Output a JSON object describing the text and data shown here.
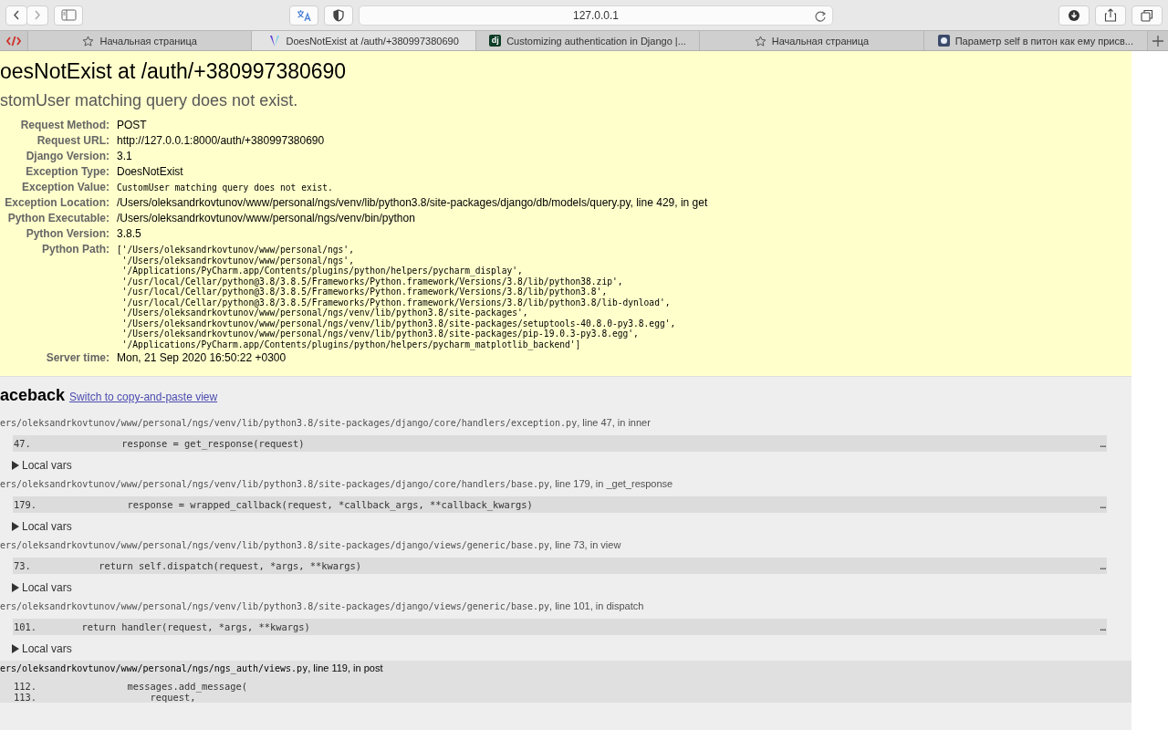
{
  "toolbar": {
    "address": "127.0.0.1"
  },
  "tabs": [
    {
      "title": "Начальная страница",
      "kind": "star",
      "selected": false
    },
    {
      "title": "DoesNotExist at /auth/+380997380690",
      "kind": "logo",
      "selected": true
    },
    {
      "title": "Customizing authentication in Django |...",
      "kind": "dj",
      "icon_text": "dj",
      "selected": false
    },
    {
      "title": "Начальная страница",
      "kind": "star",
      "selected": false
    },
    {
      "title": "Параметр self в питон как ему присв...",
      "kind": "square",
      "selected": false
    }
  ],
  "summary": {
    "title": "oesNotExist at /auth/+380997380690",
    "subtitle": "stomUser matching query does not exist.",
    "meta": [
      {
        "label": "Request Method:",
        "kind": "text",
        "value": "POST"
      },
      {
        "label": "Request URL:",
        "kind": "text",
        "value": "http://127.0.0.1:8000/auth/+380997380690"
      },
      {
        "label": "Django Version:",
        "kind": "text",
        "value": "3.1"
      },
      {
        "label": "Exception Type:",
        "kind": "text",
        "value": "DoesNotExist"
      },
      {
        "label": "Exception Value:",
        "kind": "code",
        "lines": [
          "CustomUser matching query does not exist."
        ]
      },
      {
        "label": "Exception Location:",
        "kind": "text",
        "value": "/Users/oleksandrkovtunov/www/personal/ngs/venv/lib/python3.8/site-packages/django/db/models/query.py, line 429, in get"
      },
      {
        "label": "Python Executable:",
        "kind": "text",
        "value": "/Users/oleksandrkovtunov/www/personal/ngs/venv/bin/python"
      },
      {
        "label": "Python Version:",
        "kind": "text",
        "value": "3.8.5"
      },
      {
        "label": "Python Path:",
        "kind": "code",
        "lines": [
          "['/Users/oleksandrkovtunov/www/personal/ngs',",
          " '/Users/oleksandrkovtunov/www/personal/ngs',",
          " '/Applications/PyCharm.app/Contents/plugins/python/helpers/pycharm_display',",
          " '/usr/local/Cellar/python@3.8/3.8.5/Frameworks/Python.framework/Versions/3.8/lib/python38.zip',",
          " '/usr/local/Cellar/python@3.8/3.8.5/Frameworks/Python.framework/Versions/3.8/lib/python3.8',",
          " '/usr/local/Cellar/python@3.8/3.8.5/Frameworks/Python.framework/Versions/3.8/lib/python3.8/lib-dynload',",
          " '/Users/oleksandrkovtunov/www/personal/ngs/venv/lib/python3.8/site-packages',",
          " '/Users/oleksandrkovtunov/www/personal/ngs/venv/lib/python3.8/site-packages/setuptools-40.8.0-py3.8.egg',",
          " '/Users/oleksandrkovtunov/www/personal/ngs/venv/lib/python3.8/site-packages/pip-19.0.3-py3.8.egg',",
          " '/Applications/PyCharm.app/Contents/plugins/python/helpers/pycharm_matplotlib_backend']"
        ]
      },
      {
        "label": "Server time:",
        "kind": "text",
        "value": "Mon, 21 Sep 2020 16:50:22 +0300"
      }
    ]
  },
  "traceback": {
    "heading": "aceback",
    "link": "Switch to copy-and-paste view",
    "frames": [
      {
        "path": "ers/oleksandrkovtunov/www/personal/ngs/venv/lib/python3.8/site-packages/django/core/handlers/exception.py",
        "location": ", line 47, in inner",
        "user_code": false,
        "lines": [
          {
            "number": "47.",
            "code": "         response = get_response(request)",
            "current": true
          }
        ],
        "ellipsis": "…",
        "local_vars": "Local vars"
      },
      {
        "path": "ers/oleksandrkovtunov/www/personal/ngs/venv/lib/python3.8/site-packages/django/core/handlers/base.py",
        "location": ", line 179, in _get_response",
        "user_code": false,
        "lines": [
          {
            "number": "179.",
            "code": "          response = wrapped_callback(request, *callback_args, **callback_kwargs)",
            "current": true
          }
        ],
        "ellipsis": "…",
        "local_vars": "Local vars"
      },
      {
        "path": "ers/oleksandrkovtunov/www/personal/ngs/venv/lib/python3.8/site-packages/django/views/generic/base.py",
        "location": ", line 73, in view",
        "user_code": false,
        "lines": [
          {
            "number": "73.",
            "code": "     return self.dispatch(request, *args, **kwargs)",
            "current": true
          }
        ],
        "ellipsis": "…",
        "local_vars": "Local vars"
      },
      {
        "path": "ers/oleksandrkovtunov/www/personal/ngs/venv/lib/python3.8/site-packages/django/views/generic/base.py",
        "location": ", line 101, in dispatch",
        "user_code": false,
        "lines": [
          {
            "number": "101.",
            "code": "  return handler(request, *args, **kwargs)",
            "current": true
          }
        ],
        "ellipsis": "…",
        "local_vars": "Local vars"
      },
      {
        "path": "ers/oleksandrkovtunov/www/personal/ngs/ngs_auth/views.py",
        "location": ", line 119, in post",
        "user_code": true,
        "lines": [
          {
            "number": "112.",
            "code": "          messages.add_message(",
            "current": false
          },
          {
            "number": "113.",
            "code": "              request,",
            "current": false
          }
        ]
      }
    ]
  }
}
